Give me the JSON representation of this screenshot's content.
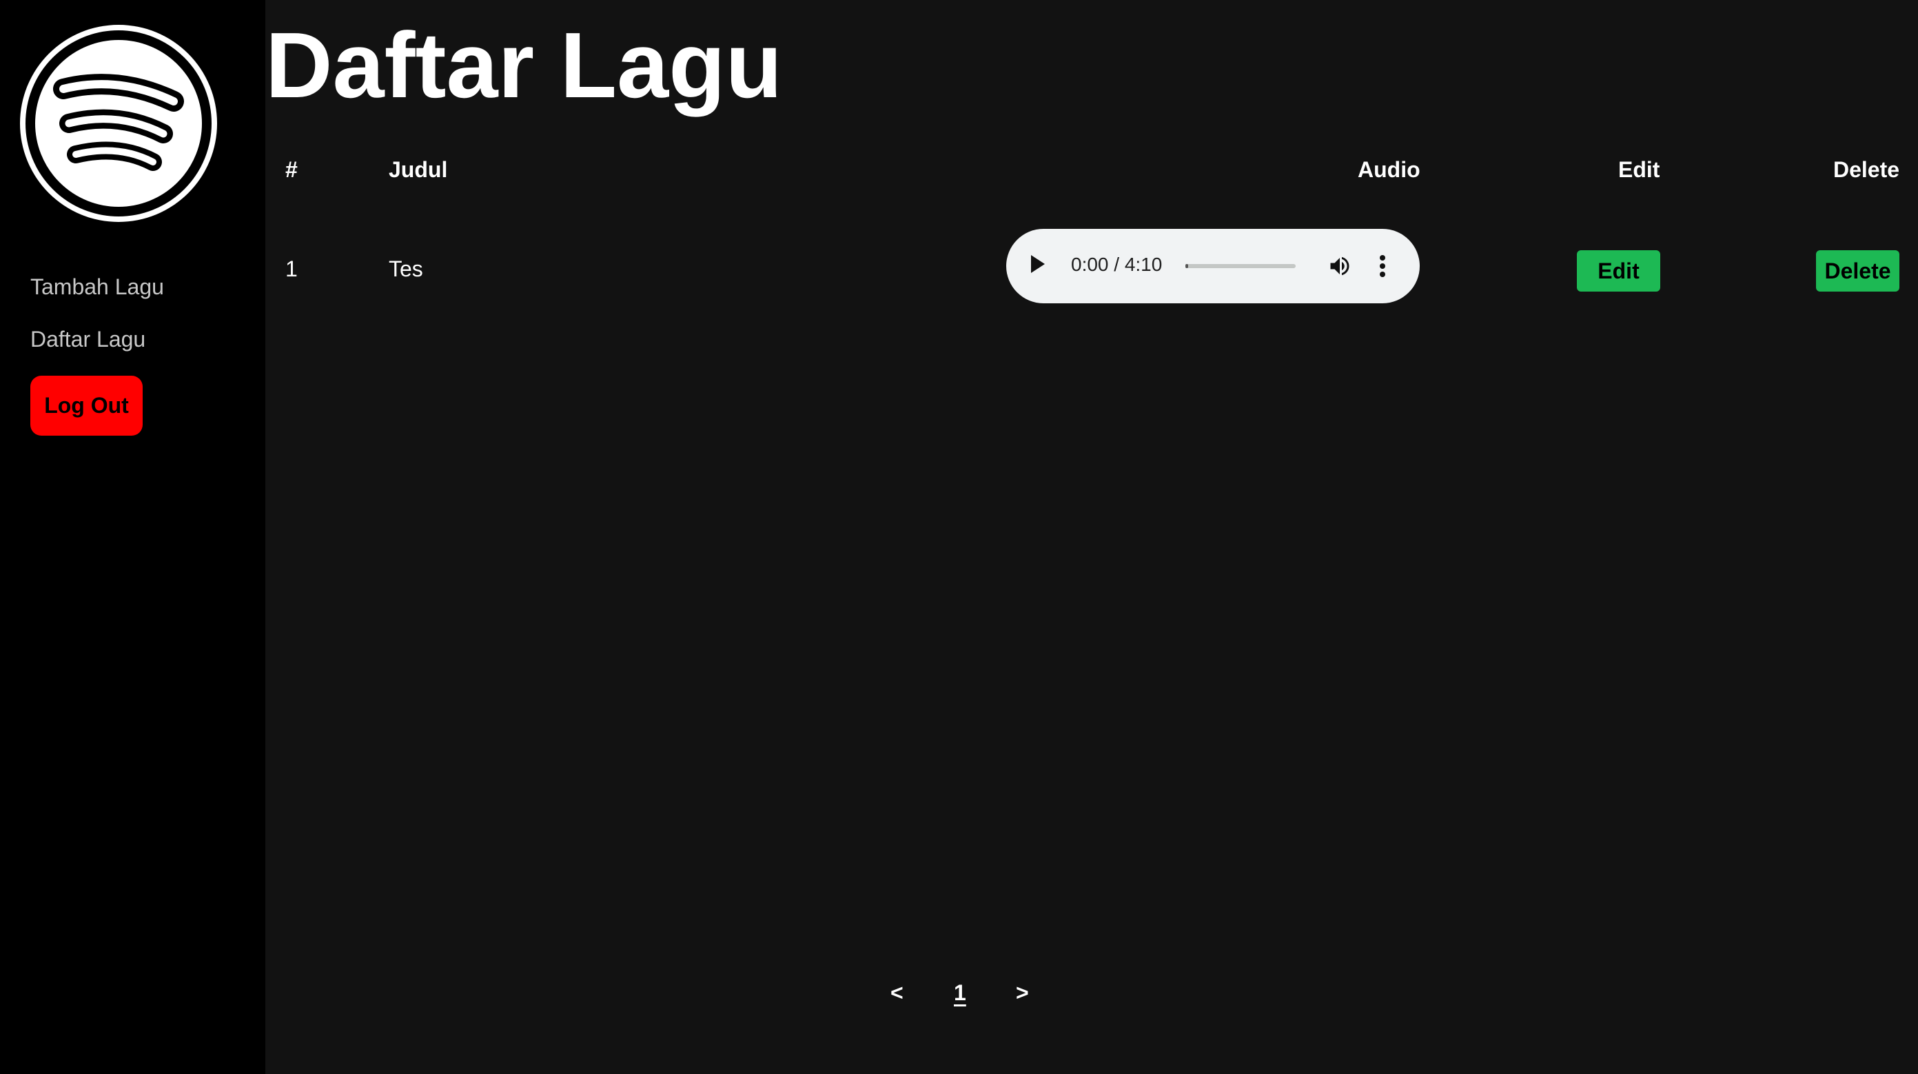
{
  "sidebar": {
    "logo": "spotify-logo",
    "items": [
      {
        "label": "Tambah Lagu"
      },
      {
        "label": "Daftar Lagu"
      }
    ],
    "logout_label": "Log Out"
  },
  "main": {
    "title": "Daftar Lagu",
    "table": {
      "headers": {
        "number": "#",
        "title": "Judul",
        "audio": "Audio",
        "edit": "Edit",
        "delete": "Delete"
      },
      "rows": [
        {
          "number": "1",
          "title": "Tes",
          "audio_time": "0:00 / 4:10",
          "audio_progress": 0,
          "edit_label": "Edit",
          "delete_label": "Delete"
        }
      ]
    },
    "pagination": {
      "prev": "<",
      "pages": [
        "1"
      ],
      "next": ">"
    }
  },
  "colors": {
    "sidebar_bg": "#000000",
    "main_bg": "#121212",
    "logout": "#ff0000",
    "action_green": "#1db954",
    "audio_bg": "#f1f3f4"
  },
  "icons": {
    "play": "play-icon",
    "volume": "volume-icon",
    "more": "more-vert-icon"
  }
}
